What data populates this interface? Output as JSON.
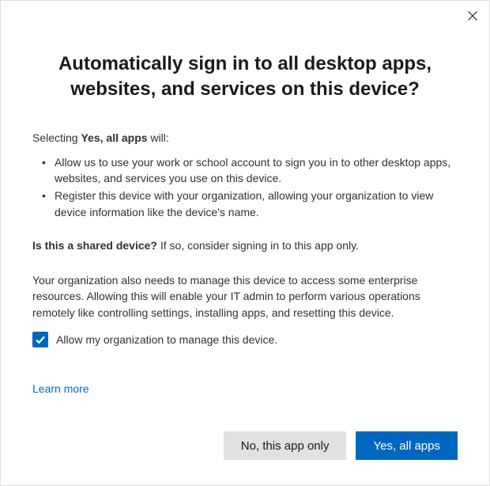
{
  "title": "Automatically sign in to all desktop apps, websites, and services on this device?",
  "intro": {
    "prefix": "Selecting ",
    "bold": "Yes, all apps",
    "suffix": " will:"
  },
  "bullets": [
    "Allow us to use your work or school account to sign you in to other desktop apps, websites, and services you use on this device.",
    "Register this device with your organization, allowing your organization to view device information like the device's name."
  ],
  "shared": {
    "bold": "Is this a shared device?",
    "rest": " If so, consider signing in to this app only."
  },
  "manage_text": "Your organization also needs to manage this device to access some enterprise resources. Allowing this will enable your IT admin to perform various operations remotely like controlling settings, installing apps, and resetting this device.",
  "checkbox": {
    "checked": true,
    "label": "Allow my organization to manage this device."
  },
  "learn_more": "Learn more",
  "buttons": {
    "secondary": "No, this app only",
    "primary": "Yes, all apps"
  }
}
